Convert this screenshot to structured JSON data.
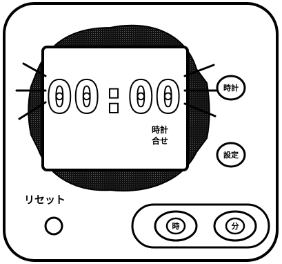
{
  "display": {
    "time": "00:00",
    "indicator_line1": "時計",
    "indicator_line2": "合せ"
  },
  "buttons": {
    "clock_label": "時計",
    "set_label": "設定",
    "reset_label": "リセット",
    "hour_label": "時",
    "minute_label": "分"
  },
  "colors": {
    "outline": "#000000",
    "body": "#ffffff",
    "halo": "#1a1a1a"
  }
}
